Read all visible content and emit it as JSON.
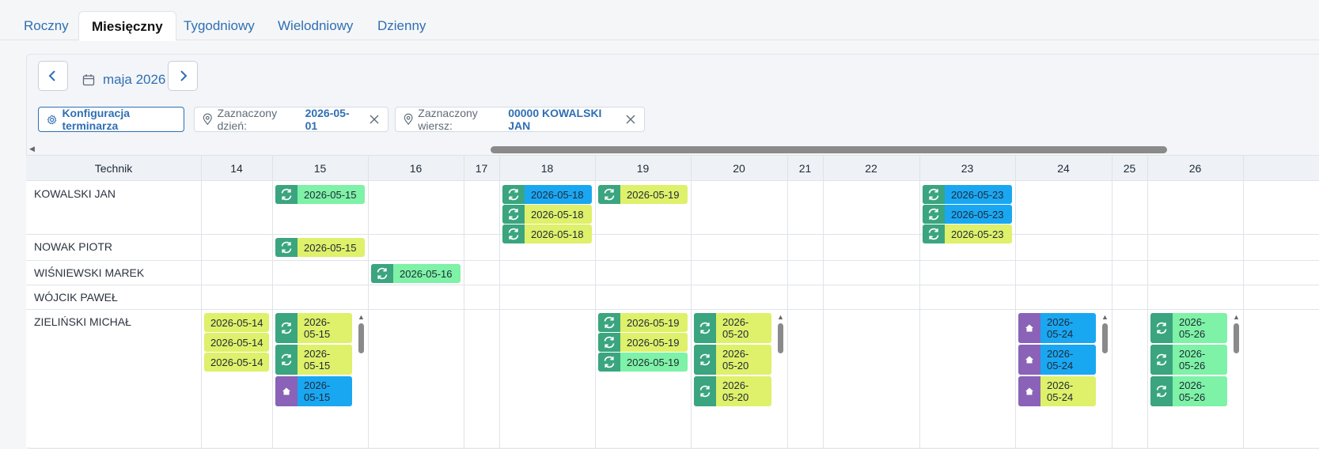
{
  "tabs": [
    {
      "label": "Roczny",
      "active": false
    },
    {
      "label": "Miesięczny",
      "active": true
    },
    {
      "label": "Tygodniowy",
      "active": false
    },
    {
      "label": "Wielodniowy",
      "active": false
    },
    {
      "label": "Dzienny",
      "active": false
    }
  ],
  "toolbar": {
    "month_label": "maja 2026",
    "config_button": "Konfiguracja terminarza",
    "selected_day_label": "Zaznaczony dzień:",
    "selected_day_value": "2026-05-01",
    "selected_row_label": "Zaznaczony wiersz:",
    "selected_row_value": "00000 KOWALSKI JAN"
  },
  "grid": {
    "tech_header": "Technik",
    "days": [
      "14",
      "15",
      "16",
      "17",
      "18",
      "19",
      "20",
      "21",
      "22",
      "23",
      "24",
      "25",
      "26"
    ],
    "rows": [
      "KOWALSKI JAN",
      "NOWAK PIOTR",
      "WIŚNIEWSKI MAREK",
      "WÓJCIK PAWEŁ",
      "ZIELIŃSKI MICHAŁ"
    ],
    "events": [
      {
        "row": 0,
        "day": "15",
        "slot": 0,
        "date": "2026-05-15",
        "icon": "refresh-icon",
        "color": "green"
      },
      {
        "row": 0,
        "day": "18",
        "slot": 0,
        "date": "2026-05-18",
        "icon": "refresh-icon",
        "color": "blue"
      },
      {
        "row": 0,
        "day": "18",
        "slot": 1,
        "date": "2026-05-18",
        "icon": "refresh-icon",
        "color": "yellow"
      },
      {
        "row": 0,
        "day": "18",
        "slot": 2,
        "date": "2026-05-18",
        "icon": "refresh-icon",
        "color": "yellow"
      },
      {
        "row": 0,
        "day": "19",
        "slot": 0,
        "date": "2026-05-19",
        "icon": "refresh-icon",
        "color": "yellow"
      },
      {
        "row": 0,
        "day": "23",
        "slot": 0,
        "date": "2026-05-23",
        "icon": "refresh-icon",
        "color": "blue"
      },
      {
        "row": 0,
        "day": "23",
        "slot": 1,
        "date": "2026-05-23",
        "icon": "refresh-icon",
        "color": "blue"
      },
      {
        "row": 0,
        "day": "23",
        "slot": 2,
        "date": "2026-05-23",
        "icon": "refresh-icon",
        "color": "yellow"
      },
      {
        "row": 1,
        "day": "15",
        "slot": 0,
        "date": "2026-05-15",
        "icon": "refresh-icon",
        "color": "yellow"
      },
      {
        "row": 2,
        "day": "16",
        "slot": 0,
        "date": "2026-05-16",
        "icon": "refresh-icon",
        "color": "green"
      },
      {
        "row": 4,
        "day": "14",
        "slot": 0,
        "date": "2026-05-14",
        "icon": "",
        "color": "yellow"
      },
      {
        "row": 4,
        "day": "14",
        "slot": 1,
        "date": "2026-05-14",
        "icon": "",
        "color": "yellow"
      },
      {
        "row": 4,
        "day": "14",
        "slot": 2,
        "date": "2026-05-14",
        "icon": "",
        "color": "yellow"
      },
      {
        "row": 4,
        "day": "15",
        "slot": 0,
        "date": "2026-05-15",
        "icon": "refresh-icon",
        "color": "yellow",
        "tall": true
      },
      {
        "row": 4,
        "day": "15",
        "slot": 1,
        "date": "2026-05-15",
        "icon": "refresh-icon",
        "color": "yellow",
        "tall": true
      },
      {
        "row": 4,
        "day": "15",
        "slot": 2,
        "date": "2026-05-15",
        "icon": "home-icon",
        "color": "blue",
        "tall": true
      },
      {
        "row": 4,
        "day": "19",
        "slot": 0,
        "date": "2026-05-19",
        "icon": "refresh-icon",
        "color": "yellow"
      },
      {
        "row": 4,
        "day": "19",
        "slot": 1,
        "date": "2026-05-19",
        "icon": "refresh-icon",
        "color": "yellow"
      },
      {
        "row": 4,
        "day": "19",
        "slot": 2,
        "date": "2026-05-19",
        "icon": "refresh-icon",
        "color": "green"
      },
      {
        "row": 4,
        "day": "20",
        "slot": 0,
        "date": "2026-05-20",
        "icon": "refresh-icon",
        "color": "yellow",
        "tall": true
      },
      {
        "row": 4,
        "day": "20",
        "slot": 1,
        "date": "2026-05-20",
        "icon": "refresh-icon",
        "color": "yellow",
        "tall": true
      },
      {
        "row": 4,
        "day": "20",
        "slot": 2,
        "date": "2026-05-20",
        "icon": "refresh-icon",
        "color": "yellow",
        "tall": true
      },
      {
        "row": 4,
        "day": "24",
        "slot": 0,
        "date": "2026-05-24",
        "icon": "home-icon",
        "color": "blue",
        "tall": true
      },
      {
        "row": 4,
        "day": "24",
        "slot": 1,
        "date": "2026-05-24",
        "icon": "home-icon",
        "color": "blue",
        "tall": true
      },
      {
        "row": 4,
        "day": "24",
        "slot": 2,
        "date": "2026-05-24",
        "icon": "home-icon",
        "color": "yellow",
        "tall": true
      },
      {
        "row": 4,
        "day": "26",
        "slot": 0,
        "date": "2026-05-26",
        "icon": "refresh-icon",
        "color": "green",
        "tall": true
      },
      {
        "row": 4,
        "day": "26",
        "slot": 1,
        "date": "2026-05-26",
        "icon": "refresh-icon",
        "color": "green",
        "tall": true
      },
      {
        "row": 4,
        "day": "26",
        "slot": 2,
        "date": "2026-05-26",
        "icon": "refresh-icon",
        "color": "green",
        "tall": true
      }
    ]
  },
  "colors": {
    "green": "#7ef2a6",
    "blue": "#1aa7f2",
    "yellow": "#dff06a",
    "icon_teal": "#3aa57f",
    "icon_purple": "#8a63b8",
    "accent": "#2f6fb3"
  }
}
